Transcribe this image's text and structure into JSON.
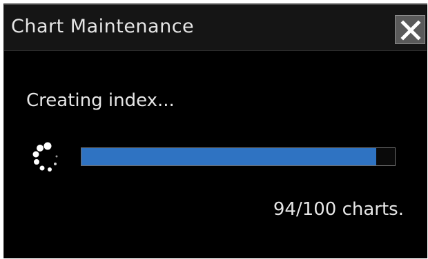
{
  "dialog": {
    "title": "Chart Maintenance",
    "close_icon": "close-icon"
  },
  "status": {
    "message": "Creating index..."
  },
  "progress": {
    "current": 94,
    "total": 100,
    "fraction": 0.94,
    "label": "94/100 charts."
  },
  "colors": {
    "background": "#000000",
    "titlebar": "#151515",
    "text": "#e6e6e6",
    "progress_fill": "#2f73c2",
    "close_button": "#5a5a5a"
  }
}
